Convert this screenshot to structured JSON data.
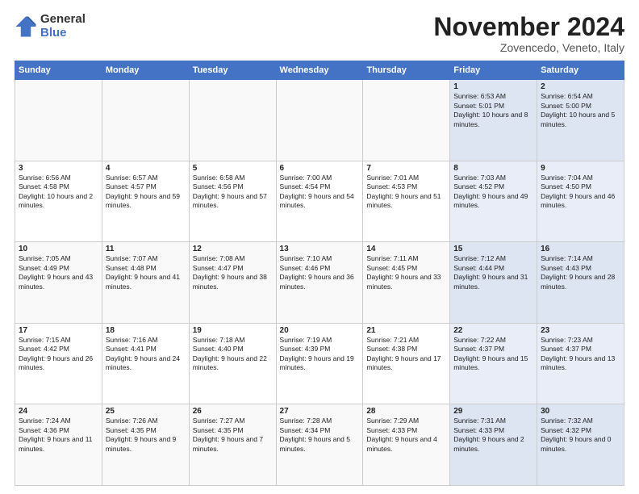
{
  "logo": {
    "general": "General",
    "blue": "Blue"
  },
  "title": "November 2024",
  "location": "Zovencedo, Veneto, Italy",
  "days_of_week": [
    "Sunday",
    "Monday",
    "Tuesday",
    "Wednesday",
    "Thursday",
    "Friday",
    "Saturday"
  ],
  "weeks": [
    [
      {
        "day": "",
        "info": ""
      },
      {
        "day": "",
        "info": ""
      },
      {
        "day": "",
        "info": ""
      },
      {
        "day": "",
        "info": ""
      },
      {
        "day": "",
        "info": ""
      },
      {
        "day": "1",
        "info": "Sunrise: 6:53 AM\nSunset: 5:01 PM\nDaylight: 10 hours and 8 minutes."
      },
      {
        "day": "2",
        "info": "Sunrise: 6:54 AM\nSunset: 5:00 PM\nDaylight: 10 hours and 5 minutes."
      }
    ],
    [
      {
        "day": "3",
        "info": "Sunrise: 6:56 AM\nSunset: 4:58 PM\nDaylight: 10 hours and 2 minutes."
      },
      {
        "day": "4",
        "info": "Sunrise: 6:57 AM\nSunset: 4:57 PM\nDaylight: 9 hours and 59 minutes."
      },
      {
        "day": "5",
        "info": "Sunrise: 6:58 AM\nSunset: 4:56 PM\nDaylight: 9 hours and 57 minutes."
      },
      {
        "day": "6",
        "info": "Sunrise: 7:00 AM\nSunset: 4:54 PM\nDaylight: 9 hours and 54 minutes."
      },
      {
        "day": "7",
        "info": "Sunrise: 7:01 AM\nSunset: 4:53 PM\nDaylight: 9 hours and 51 minutes."
      },
      {
        "day": "8",
        "info": "Sunrise: 7:03 AM\nSunset: 4:52 PM\nDaylight: 9 hours and 49 minutes."
      },
      {
        "day": "9",
        "info": "Sunrise: 7:04 AM\nSunset: 4:50 PM\nDaylight: 9 hours and 46 minutes."
      }
    ],
    [
      {
        "day": "10",
        "info": "Sunrise: 7:05 AM\nSunset: 4:49 PM\nDaylight: 9 hours and 43 minutes."
      },
      {
        "day": "11",
        "info": "Sunrise: 7:07 AM\nSunset: 4:48 PM\nDaylight: 9 hours and 41 minutes."
      },
      {
        "day": "12",
        "info": "Sunrise: 7:08 AM\nSunset: 4:47 PM\nDaylight: 9 hours and 38 minutes."
      },
      {
        "day": "13",
        "info": "Sunrise: 7:10 AM\nSunset: 4:46 PM\nDaylight: 9 hours and 36 minutes."
      },
      {
        "day": "14",
        "info": "Sunrise: 7:11 AM\nSunset: 4:45 PM\nDaylight: 9 hours and 33 minutes."
      },
      {
        "day": "15",
        "info": "Sunrise: 7:12 AM\nSunset: 4:44 PM\nDaylight: 9 hours and 31 minutes."
      },
      {
        "day": "16",
        "info": "Sunrise: 7:14 AM\nSunset: 4:43 PM\nDaylight: 9 hours and 28 minutes."
      }
    ],
    [
      {
        "day": "17",
        "info": "Sunrise: 7:15 AM\nSunset: 4:42 PM\nDaylight: 9 hours and 26 minutes."
      },
      {
        "day": "18",
        "info": "Sunrise: 7:16 AM\nSunset: 4:41 PM\nDaylight: 9 hours and 24 minutes."
      },
      {
        "day": "19",
        "info": "Sunrise: 7:18 AM\nSunset: 4:40 PM\nDaylight: 9 hours and 22 minutes."
      },
      {
        "day": "20",
        "info": "Sunrise: 7:19 AM\nSunset: 4:39 PM\nDaylight: 9 hours and 19 minutes."
      },
      {
        "day": "21",
        "info": "Sunrise: 7:21 AM\nSunset: 4:38 PM\nDaylight: 9 hours and 17 minutes."
      },
      {
        "day": "22",
        "info": "Sunrise: 7:22 AM\nSunset: 4:37 PM\nDaylight: 9 hours and 15 minutes."
      },
      {
        "day": "23",
        "info": "Sunrise: 7:23 AM\nSunset: 4:37 PM\nDaylight: 9 hours and 13 minutes."
      }
    ],
    [
      {
        "day": "24",
        "info": "Sunrise: 7:24 AM\nSunset: 4:36 PM\nDaylight: 9 hours and 11 minutes."
      },
      {
        "day": "25",
        "info": "Sunrise: 7:26 AM\nSunset: 4:35 PM\nDaylight: 9 hours and 9 minutes."
      },
      {
        "day": "26",
        "info": "Sunrise: 7:27 AM\nSunset: 4:35 PM\nDaylight: 9 hours and 7 minutes."
      },
      {
        "day": "27",
        "info": "Sunrise: 7:28 AM\nSunset: 4:34 PM\nDaylight: 9 hours and 5 minutes."
      },
      {
        "day": "28",
        "info": "Sunrise: 7:29 AM\nSunset: 4:33 PM\nDaylight: 9 hours and 4 minutes."
      },
      {
        "day": "29",
        "info": "Sunrise: 7:31 AM\nSunset: 4:33 PM\nDaylight: 9 hours and 2 minutes."
      },
      {
        "day": "30",
        "info": "Sunrise: 7:32 AM\nSunset: 4:32 PM\nDaylight: 9 hours and 0 minutes."
      }
    ]
  ]
}
